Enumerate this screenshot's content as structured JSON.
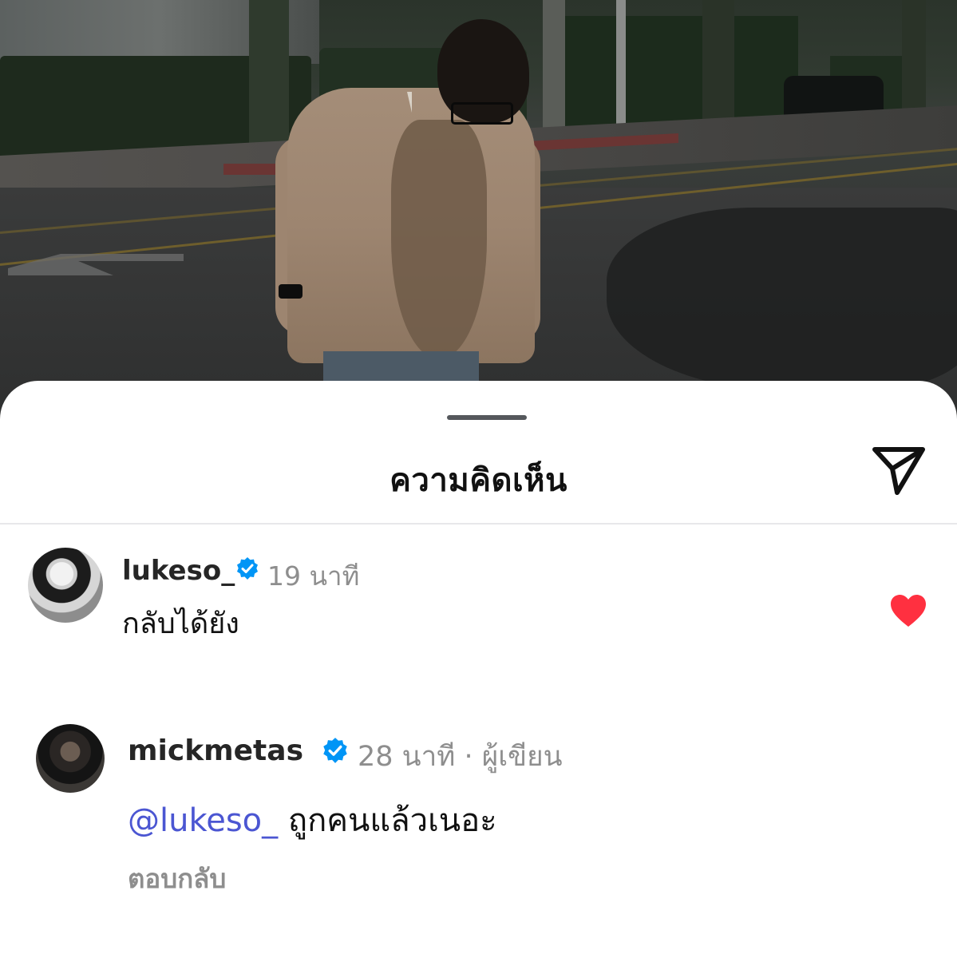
{
  "sheet": {
    "title": "ความคิดเห็น"
  },
  "comments": [
    {
      "username": "lukeso_",
      "verified": true,
      "time": "19 นาที",
      "text": "กลับได้ยัง",
      "liked": true
    },
    {
      "username": "mickmetas",
      "verified": true,
      "time": "28 นาที · ผู้เขียน",
      "mention": "@lukeso_",
      "text": "ถูกคนแล้วเนอะ",
      "reply_label": "ตอบกลับ"
    }
  ],
  "colors": {
    "verified_badge": "#0095f6",
    "heart": "#ff3040",
    "mention": "#4b56d2",
    "meta_text": "#8e8e8e"
  }
}
